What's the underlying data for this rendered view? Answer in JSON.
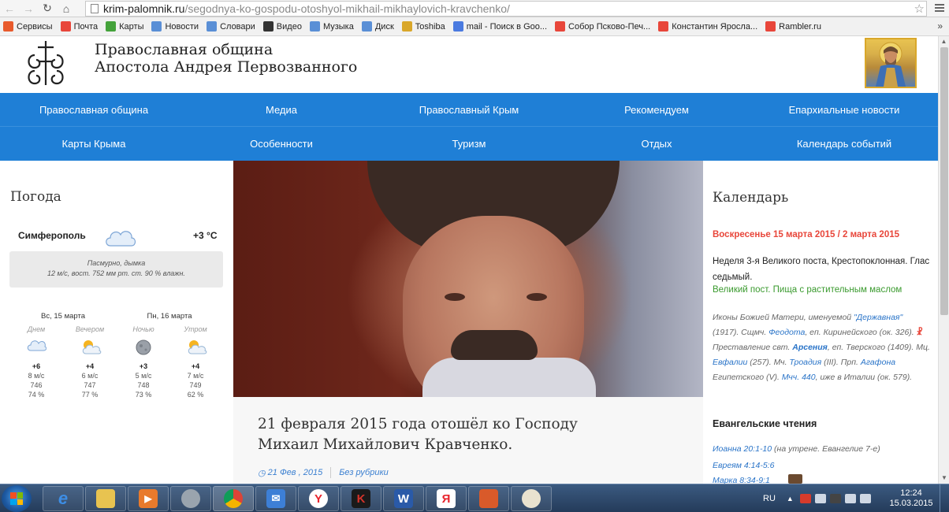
{
  "browser": {
    "url_host": "krim-palomnik.ru",
    "url_path": "/segodnya-ko-gospodu-otoshyol-mikhail-mikhaylovich-kravchenko/",
    "bookmarks": [
      {
        "label": "Сервисы",
        "icon": "apps-grid-icon",
        "color": "#e85a2c"
      },
      {
        "label": "Почта",
        "icon": "yandex-icon",
        "color": "#e8463a"
      },
      {
        "label": "Карты",
        "icon": "maps-icon",
        "color": "#44a23a"
      },
      {
        "label": "Новости",
        "icon": "page-icon",
        "color": "#5a8fd6"
      },
      {
        "label": "Словари",
        "icon": "page-icon",
        "color": "#5a8fd6"
      },
      {
        "label": "Видео",
        "icon": "video-icon",
        "color": "#333333"
      },
      {
        "label": "Музыка",
        "icon": "music-icon",
        "color": "#5a8fd6"
      },
      {
        "label": "Диск",
        "icon": "disk-icon",
        "color": "#5a8fd6"
      },
      {
        "label": "Toshiba",
        "icon": "folder-icon",
        "color": "#d9a72a"
      },
      {
        "label": "mail - Поиск в Goo...",
        "icon": "google-icon",
        "color": "#4a7ae0"
      },
      {
        "label": "Собор Псково-Печ...",
        "icon": "yandex-icon",
        "color": "#e8463a"
      },
      {
        "label": "Константин Яросла...",
        "icon": "yandex-icon",
        "color": "#e8463a"
      },
      {
        "label": "Rambler.ru",
        "icon": "yandex-icon",
        "color": "#e8463a"
      }
    ],
    "more": "»"
  },
  "site": {
    "title_line1": "Православная община",
    "title_line2": "Апостола Андрея Первозванного"
  },
  "nav": {
    "row1": [
      "Православная община",
      "Медиа",
      "Православный Крым",
      "Рекомендуем",
      "Епархиальные новости"
    ],
    "row2": [
      "Карты Крыма",
      "Особенности",
      "Туризм",
      "Отдых",
      "Календарь событий"
    ],
    "color": "#1f7fd6"
  },
  "weather": {
    "heading": "Погода",
    "city": "Симферополь",
    "temp": "+3 °С",
    "desc1": "Пасмурно, дымка",
    "desc2": "12 м/с, вост.   752 мм рт. ст.   90 % влажн.",
    "days": [
      "Вс, 15 марта",
      "Пн, 16 марта"
    ],
    "forecast": [
      {
        "label": "Днем",
        "icon": "cloud-rain-icon",
        "temp": "+6",
        "wind": "8 м/с",
        "pressure": "746",
        "humidity": "74 %"
      },
      {
        "label": "Вечером",
        "icon": "sun-cloud-icon",
        "temp": "+4",
        "wind": "6 м/с",
        "pressure": "747",
        "humidity": "77 %"
      },
      {
        "label": "Ночью",
        "icon": "moon-icon",
        "temp": "+3",
        "wind": "5 м/с",
        "pressure": "748",
        "humidity": "73 %"
      },
      {
        "label": "Утром",
        "icon": "sun-cloud-icon",
        "temp": "+4",
        "wind": "7 м/с",
        "pressure": "749",
        "humidity": "62 %"
      }
    ]
  },
  "article": {
    "title": "21 февраля 2015 года отошёл ко Господу Михаил Михайлович Кравченко.",
    "date": "21 Фев , 2015",
    "category": "Без рубрики"
  },
  "calendar": {
    "heading": "Календарь",
    "date": "Воскресенье 15 марта 2015 / 2 марта 2015",
    "week": "Неделя 3-я Великого поста, Крестопоклонная. Глас седьмый.",
    "fast": "Великий пост. Пища с растительным маслом",
    "saints": {
      "s1": "Иконы Божией Матери, именуемой ",
      "l1": "\"Державная\"",
      "s2": " (1917). Сщмч. ",
      "l2": "Феодота",
      "s3": ", еп. Киринейского (ок. 326). ",
      "s4": " Преставление свт. ",
      "l3": "Арсения",
      "s5": ", еп. Тверского (1409). Мц. ",
      "l4": "Евфалии",
      "s6": " (257). Мч. ",
      "l5": "Троадия",
      "s7": " (III). Прп. ",
      "l6": "Агафона",
      "s8": " Египетского (V). ",
      "l7": "Мчч. 440",
      "s9": ", иже в Италии (ок. 579)."
    },
    "gospel_heading": "Евангельские чтения",
    "gospel1": "Иоанна 20:1-10",
    "gospel1_note": " (на утрене. Евангелие 7-е)",
    "gospel2": "Евреям 4:14-5:6",
    "gospel3": "Марка 8:34-9:1"
  },
  "taskbar": {
    "apps": [
      "start-icon",
      "ie-icon",
      "explorer-icon",
      "media-icon",
      "disc-icon",
      "chrome-icon",
      "mail-icon",
      "yandex-browser-icon",
      "kaspersky-icon",
      "word-icon",
      "yandex-icon",
      "toolbox-icon",
      "paint-icon"
    ],
    "lang": "RU",
    "time": "12:24",
    "date": "15.03.2015"
  }
}
